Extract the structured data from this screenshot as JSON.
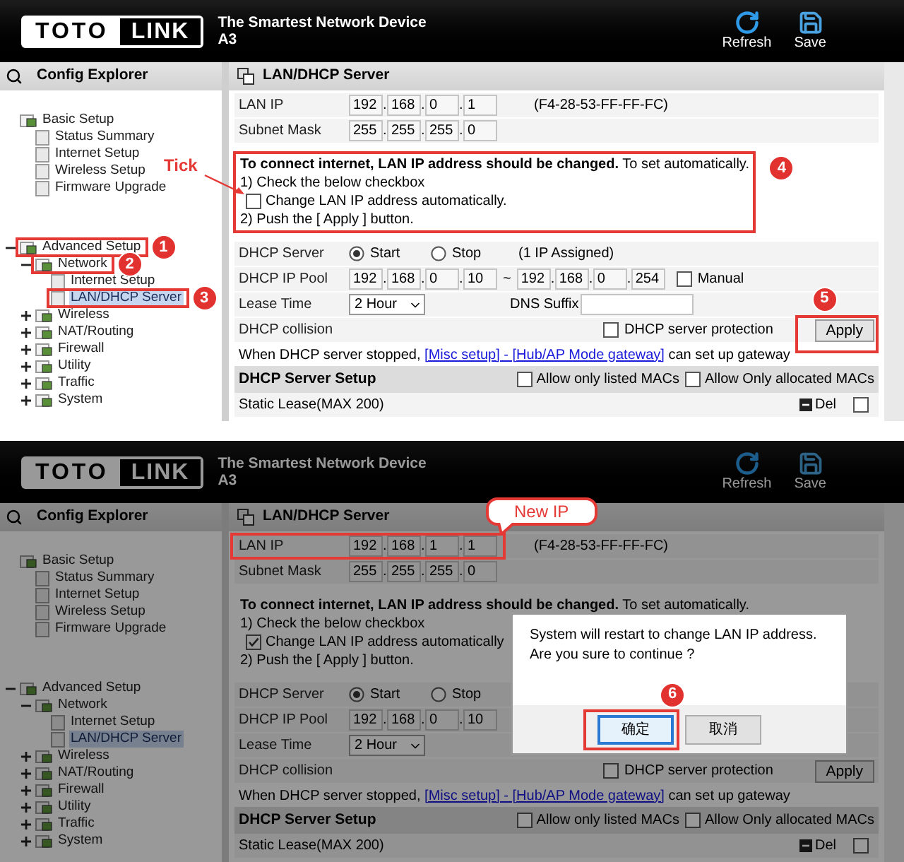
{
  "steps": [
    {
      "header": {
        "logo": [
          "TOTO",
          "LINK"
        ],
        "tagline": "The Smartest Network Device",
        "model": "A3",
        "actions": [
          {
            "kind": "refresh",
            "label": "Refresh"
          },
          {
            "kind": "save",
            "label": "Save"
          }
        ]
      },
      "sidebar": {
        "title": "Config Explorer",
        "tree": [
          {
            "label": "Basic Setup",
            "selected": false,
            "children": [
              {
                "label": "Status Summary",
                "selected": false
              },
              {
                "label": "Internet Setup",
                "selected": false
              },
              {
                "label": "Wireless Setup",
                "selected": false
              },
              {
                "label": "Firmware Upgrade",
                "selected": false
              }
            ]
          },
          {
            "label": "Advanced Setup",
            "selected": false,
            "expanded": true,
            "badge": "1",
            "children": [
              {
                "label": "Network",
                "selected": false,
                "expanded": true,
                "badge": "2",
                "children": [
                  {
                    "label": "Internet Setup",
                    "selected": false
                  },
                  {
                    "label": "LAN/DHCP Server",
                    "selected": true,
                    "badge": "3"
                  }
                ]
              },
              {
                "label": "Wireless",
                "selected": false,
                "expanded": false
              },
              {
                "label": "NAT/Routing",
                "selected": false,
                "expanded": false
              },
              {
                "label": "Firewall",
                "selected": false,
                "expanded": false
              },
              {
                "label": "Utility",
                "selected": false,
                "expanded": false
              },
              {
                "label": "Traffic",
                "selected": false,
                "expanded": false
              },
              {
                "label": "System",
                "selected": false,
                "expanded": false
              }
            ]
          }
        ]
      },
      "panel": {
        "title": "LAN/DHCP Server",
        "lan_ip": {
          "label": "LAN IP",
          "separator": ".",
          "octets": [
            "192",
            "168",
            "0",
            "1"
          ],
          "mac": "(F4-28-53-FF-FF-FC)"
        },
        "subnet_mask": {
          "label": "Subnet Mask",
          "separator": ".",
          "octets": [
            "255",
            "255",
            "255",
            "0"
          ]
        },
        "notice": {
          "headline": "**To connect internet, LAN IP address should be changed.** To set automatically.",
          "step1": "1) Check the below checkbox",
          "checkbox": {
            "label": "Change LAN IP address automatically.",
            "checked": false,
            "callout": "Tick"
          },
          "step2": "2) Push the [ Apply ] button.",
          "badge": "4"
        },
        "dhcp_server": {
          "label": "DHCP Server",
          "options": [
            {
              "label": "Start",
              "selected": true
            },
            {
              "label": "Stop",
              "selected": false
            }
          ],
          "assigned": "(1 IP Assigned)"
        },
        "dhcp_ip_pool": {
          "label": "DHCP IP Pool",
          "separator": ".",
          "start": [
            "192",
            "168",
            "0",
            "10"
          ],
          "range_separator": "~",
          "end": [
            "192",
            "168",
            "0",
            "254"
          ],
          "manual": {
            "label": "Manual",
            "checked": false
          }
        },
        "lease_time": {
          "label": "Lease Time",
          "value": "2 Hour",
          "dns_suffix": {
            "label": "DNS Suffix"
          }
        },
        "dhcp_collision": {
          "label": "DHCP collision",
          "protection": {
            "label": "DHCP server protection",
            "checked": false
          },
          "apply": {
            "label": "Apply",
            "badge": "5"
          }
        },
        "gateway_note": {
          "text": "When DHCP server stopped,",
          "link": "[Misc setup] - [Hub/AP Mode gateway]",
          "after": "can set up gateway"
        },
        "server_setup": {
          "title": "DHCP Server Setup",
          "options": [
            {
              "label": "Allow only listed MACs",
              "checked": false
            },
            {
              "label": "Allow Only allocated MACs",
              "checked": false
            }
          ]
        },
        "static_lease": {
          "label": "Static Lease(MAX 200)",
          "delete": "Del",
          "checked": false
        }
      }
    },
    {
      "header": {
        "logo": [
          "TOTO",
          "LINK"
        ],
        "tagline": "The Smartest Network Device",
        "model": "A3",
        "actions": [
          {
            "kind": "refresh",
            "label": "Refresh"
          },
          {
            "kind": "save",
            "label": "Save"
          }
        ]
      },
      "sidebar": {
        "title": "Config Explorer",
        "tree": [
          {
            "label": "Basic Setup",
            "selected": false,
            "children": [
              {
                "label": "Status Summary",
                "selected": false
              },
              {
                "label": "Internet Setup",
                "selected": false
              },
              {
                "label": "Wireless Setup",
                "selected": false
              },
              {
                "label": "Firmware Upgrade",
                "selected": false
              }
            ]
          },
          {
            "label": "Advanced Setup",
            "selected": false,
            "expanded": true,
            "children": [
              {
                "label": "Network",
                "selected": false,
                "expanded": true,
                "children": [
                  {
                    "label": "Internet Setup",
                    "selected": false
                  },
                  {
                    "label": "LAN/DHCP Server",
                    "selected": true
                  }
                ]
              },
              {
                "label": "Wireless",
                "selected": false,
                "expanded": false
              },
              {
                "label": "NAT/Routing",
                "selected": false,
                "expanded": false
              },
              {
                "label": "Firewall",
                "selected": false,
                "expanded": false
              },
              {
                "label": "Utility",
                "selected": false,
                "expanded": false
              },
              {
                "label": "Traffic",
                "selected": false,
                "expanded": false
              },
              {
                "label": "System",
                "selected": false,
                "expanded": false
              }
            ]
          }
        ]
      },
      "panel": {
        "title": "LAN/DHCP Server",
        "lan_ip": {
          "label": "LAN IP",
          "separator": ".",
          "octets": [
            "192",
            "168",
            "1",
            "1"
          ],
          "mac": "(F4-28-53-FF-FF-FC)",
          "callout": "New IP"
        },
        "subnet_mask": {
          "label": "Subnet Mask",
          "separator": ".",
          "octets": [
            "255",
            "255",
            "255",
            "0"
          ]
        },
        "notice": {
          "headline": "**To connect internet, LAN IP address should be changed.** To set automatically.",
          "step1": "1) Check the below checkbox",
          "checkbox": {
            "label": "Change LAN IP address automatically",
            "checked": true
          },
          "step2": "2) Push the [ Apply ] button."
        },
        "dhcp_server": {
          "label": "DHCP Server",
          "options": [
            {
              "label": "Start",
              "selected": true
            },
            {
              "label": "Stop",
              "selected": false
            }
          ]
        },
        "dhcp_ip_pool": {
          "label": "DHCP IP Pool",
          "separator": ".",
          "start": [
            "192",
            "168",
            "0",
            "10"
          ]
        },
        "lease_time": {
          "label": "Lease Time",
          "value": "2 Hour"
        },
        "dhcp_collision": {
          "label": "DHCP collision",
          "protection": {
            "label": "DHCP server protection",
            "checked": false
          },
          "apply": {
            "label": "Apply"
          }
        },
        "gateway_note": {
          "text": "When DHCP server stopped,",
          "link": "[Misc setup] - [Hub/AP Mode gateway]",
          "after": "can set up gateway"
        },
        "server_setup": {
          "title": "DHCP Server Setup",
          "options": [
            {
              "label": "Allow only listed MACs",
              "checked": false
            },
            {
              "label": "Allow Only allocated MACs",
              "checked": false
            }
          ]
        },
        "static_lease": {
          "label": "Static Lease(MAX 200)",
          "delete": "Del",
          "checked": false
        }
      },
      "dialog": {
        "message": "System will restart to change LAN IP address.\nAre you sure to continue ?",
        "buttons": [
          {
            "label": "确定",
            "selected": true,
            "badge": "6"
          },
          {
            "label": "取消",
            "selected": false
          }
        ]
      }
    }
  ]
}
